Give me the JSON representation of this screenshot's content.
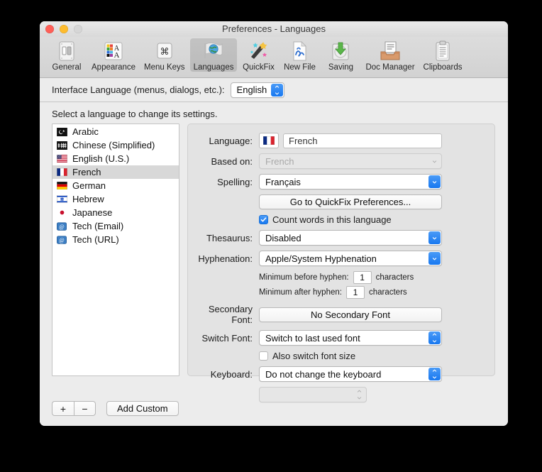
{
  "window": {
    "title": "Preferences - Languages",
    "controls": {
      "close": "close-button",
      "minimize": "minimize-button",
      "zoom": "zoom-button"
    }
  },
  "toolbar": {
    "items": [
      {
        "label": "General",
        "icon": "general-icon"
      },
      {
        "label": "Appearance",
        "icon": "appearance-icon"
      },
      {
        "label": "Menu Keys",
        "icon": "menu-keys-icon"
      },
      {
        "label": "Languages",
        "icon": "languages-icon",
        "selected": true
      },
      {
        "label": "QuickFix",
        "icon": "quickfix-icon"
      },
      {
        "label": "New File",
        "icon": "new-file-icon"
      },
      {
        "label": "Saving",
        "icon": "saving-icon"
      },
      {
        "label": "Doc Manager",
        "icon": "doc-manager-icon"
      },
      {
        "label": "Clipboards",
        "icon": "clipboards-icon"
      }
    ]
  },
  "interface_language": {
    "label": "Interface Language (menus, dialogs, etc.):",
    "value": "English"
  },
  "list_section": {
    "hint": "Select a language to change its settings.",
    "items": [
      {
        "label": "Arabic",
        "icon": "flag-arabic-icon",
        "selected": false
      },
      {
        "label": "Chinese (Simplified)",
        "icon": "flag-chinese-icon",
        "selected": false
      },
      {
        "label": "English (U.S.)",
        "icon": "flag-us-icon",
        "selected": false
      },
      {
        "label": "French",
        "icon": "flag-france-icon",
        "selected": true
      },
      {
        "label": "German",
        "icon": "flag-germany-icon",
        "selected": false
      },
      {
        "label": "Hebrew",
        "icon": "flag-israel-icon",
        "selected": false
      },
      {
        "label": "Japanese",
        "icon": "flag-japan-icon",
        "selected": false
      },
      {
        "label": "Tech (Email)",
        "icon": "at-symbol-icon",
        "selected": false
      },
      {
        "label": "Tech (URL)",
        "icon": "at-symbol-icon",
        "selected": false
      }
    ],
    "add_button": "+",
    "remove_button": "−",
    "add_custom_button": "Add Custom"
  },
  "settings": {
    "language": {
      "label": "Language:",
      "value": "French",
      "flag": "flag-france-icon"
    },
    "based_on": {
      "label": "Based on:",
      "value": "French",
      "disabled": true
    },
    "spelling": {
      "label": "Spelling:",
      "value": "Français"
    },
    "quickfix_button": "Go to QuickFix Preferences...",
    "count_words": {
      "label": "Count words in this language",
      "checked": true
    },
    "thesaurus": {
      "label": "Thesaurus:",
      "value": "Disabled"
    },
    "hyphenation": {
      "label": "Hyphenation:",
      "value": "Apple/System Hyphenation"
    },
    "min_before": {
      "label": "Minimum before hyphen:",
      "value": "1",
      "unit": "characters"
    },
    "min_after": {
      "label": "Minimum after hyphen:",
      "value": "1",
      "unit": "characters"
    },
    "secondary_font": {
      "label": "Secondary Font:",
      "value": "No Secondary Font"
    },
    "switch_font": {
      "label": "Switch Font:",
      "value": "Switch to last used font"
    },
    "also_switch_size": {
      "label": "Also switch font size",
      "checked": false
    },
    "keyboard": {
      "label": "Keyboard:",
      "value": "Do not change the keyboard"
    },
    "keyboard_layout": {
      "value": "",
      "disabled": true
    }
  },
  "colors": {
    "accent": "#1878f0",
    "selection": "#d8d8d8",
    "window_bg": "#ececec"
  }
}
